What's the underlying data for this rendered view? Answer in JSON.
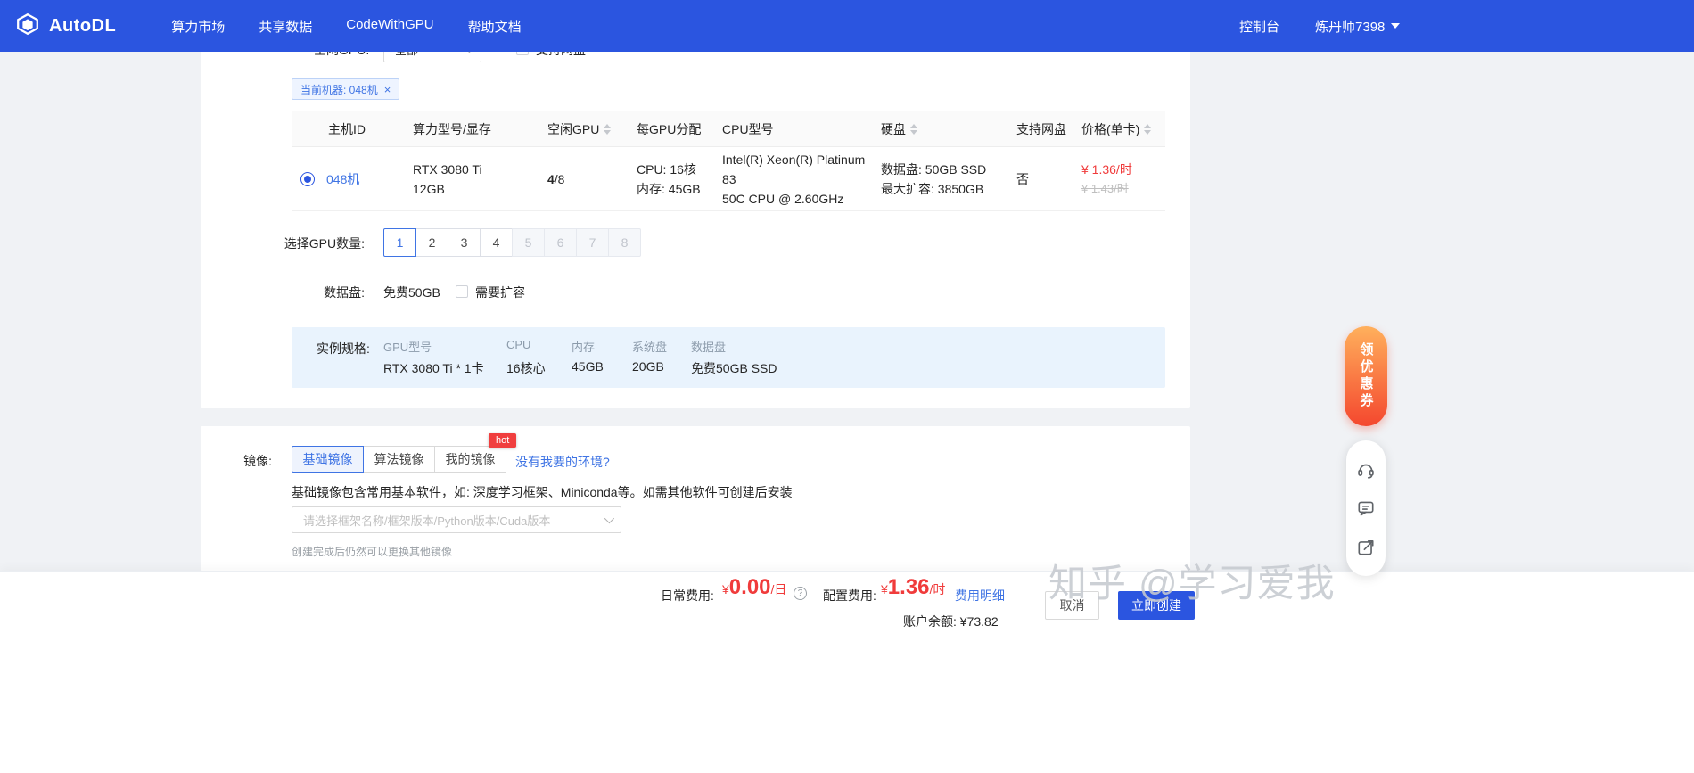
{
  "navbar": {
    "brand": "AutoDL",
    "items": [
      "算力市场",
      "共享数据",
      "CodeWithGPU",
      "帮助文档"
    ],
    "console": "控制台",
    "username": "炼丹师7398"
  },
  "filter": {
    "label": "空闲GPU:",
    "select_value": "全部",
    "checkbox_label": "支持网盘"
  },
  "machine_tag": {
    "label": "当前机器: 048机",
    "close": "×"
  },
  "host_table": {
    "headers": [
      "主机ID",
      "算力型号/显存",
      "空闲GPU",
      "每GPU分配",
      "CPU型号",
      "硬盘",
      "支持网盘",
      "价格(单卡)"
    ],
    "row": {
      "host_id": "048机",
      "gpu_model_line1": "RTX 3080 Ti",
      "gpu_model_line2": "12GB",
      "free_gpu_used": "4",
      "free_gpu_total": "/8",
      "per_gpu_line1": "CPU: 16核",
      "per_gpu_line2": "内存: 45GB",
      "cpu_line1": "Intel(R) Xeon(R) Platinum 83",
      "cpu_line2": "50C CPU @ 2.60GHz",
      "disk_line1": "数据盘: 50GB SSD",
      "disk_line2": "最大扩容: 3850GB",
      "net_disk": "否",
      "price_current": "¥ 1.36/时",
      "price_original": "¥ 1.43/时"
    }
  },
  "gpu_count": {
    "label": "选择GPU数量:",
    "options": [
      "1",
      "2",
      "3",
      "4",
      "5",
      "6",
      "7",
      "8"
    ],
    "selected": "1",
    "disabled": [
      "5",
      "6",
      "7",
      "8"
    ]
  },
  "data_disk": {
    "label": "数据盘:",
    "value": "免费50GB",
    "expand_label": "需要扩容"
  },
  "instance_spec": {
    "label": "实例规格:",
    "columns": [
      {
        "name": "GPU型号",
        "value": "RTX 3080 Ti * 1卡"
      },
      {
        "name": "CPU",
        "value": "16核心"
      },
      {
        "name": "内存",
        "value": "45GB"
      },
      {
        "name": "系统盘",
        "value": "20GB"
      },
      {
        "name": "数据盘",
        "value": "免费50GB SSD"
      }
    ]
  },
  "image_section": {
    "label": "镜像:",
    "tabs": [
      {
        "label": "基础镜像",
        "selected": true
      },
      {
        "label": "算法镜像",
        "badge": "hot"
      },
      {
        "label": "我的镜像"
      }
    ],
    "env_link": "没有我要的环境?",
    "description": "基础镜像包含常用基本软件，如: 深度学习框架、Miniconda等。如需其他软件可创建后安装",
    "select_placeholder": "请选择框架名称/框架版本/Python版本/Cuda版本",
    "note": "创建完成后仍然可以更换其他镜像"
  },
  "footer": {
    "daily_fee_label": "日常费用:",
    "daily_fee_currency": "¥",
    "daily_fee": "0.00",
    "daily_fee_unit": "/日",
    "help": "?",
    "config_fee_label": "配置费用:",
    "config_fee_currency": "¥",
    "config_fee": "1.36",
    "config_fee_unit": "/时",
    "fee_detail": "费用明细",
    "balance_label": "账户余额:",
    "balance": "¥73.82",
    "cancel": "取消",
    "create": "立即创建"
  },
  "floating": {
    "coupon": "领优惠券"
  },
  "watermark": "知乎 @学习爱我",
  "colors": {
    "navbar_blue": "#2b55e0",
    "accent_blue": "#3f74e4",
    "price_red": "#f03b3b",
    "hot_red": "#f03e3e",
    "spec_box_bg": "#e9f3fd"
  }
}
